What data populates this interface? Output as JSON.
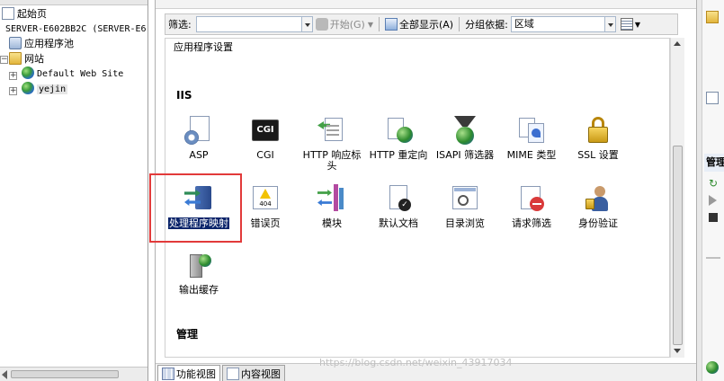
{
  "tree": {
    "items": [
      {
        "label": "起始页"
      },
      {
        "label": "SERVER-E602BB2C (SERVER-E6"
      },
      {
        "label": "应用程序池"
      },
      {
        "label": "网站"
      },
      {
        "label": "Default Web Site"
      },
      {
        "label": "yejin"
      }
    ]
  },
  "filterbar": {
    "filter_label": "筛选:",
    "start_label": "开始(G)",
    "show_all_label": "全部显示(A)",
    "group_by_label": "分组依据:",
    "group_by_value": "区域"
  },
  "sections": {
    "partial_item_label": "应用程序设置",
    "iis_header": "IIS",
    "manage_header": "管理"
  },
  "features": [
    {
      "label": "ASP",
      "icon": "asp-icon"
    },
    {
      "label": "CGI",
      "icon": "cgi-icon"
    },
    {
      "label": "HTTP 响应标头",
      "icon": "http-response-headers-icon"
    },
    {
      "label": "HTTP 重定向",
      "icon": "http-redirect-icon"
    },
    {
      "label": "ISAPI 筛选器",
      "icon": "isapi-filters-icon"
    },
    {
      "label": "MIME 类型",
      "icon": "mime-types-icon"
    },
    {
      "label": "SSL 设置",
      "icon": "ssl-settings-icon"
    },
    {
      "label": "处理程序映射",
      "icon": "handler-mappings-icon",
      "selected": true
    },
    {
      "label": "错误页",
      "icon": "error-pages-icon"
    },
    {
      "label": "模块",
      "icon": "modules-icon"
    },
    {
      "label": "默认文档",
      "icon": "default-document-icon"
    },
    {
      "label": "目录浏览",
      "icon": "directory-browsing-icon"
    },
    {
      "label": "请求筛选",
      "icon": "request-filtering-icon"
    },
    {
      "label": "身份验证",
      "icon": "authentication-icon"
    },
    {
      "label": "输出缓存",
      "icon": "output-caching-icon"
    }
  ],
  "view_tabs": {
    "features_view": "功能视图",
    "content_view": "内容视图"
  },
  "actions": {
    "header": "管理"
  },
  "watermark": "https://blog.csdn.net/weixin_43917034",
  "colors": {
    "highlight_border": "#e23a3a",
    "selection_bg": "#0a246a"
  }
}
